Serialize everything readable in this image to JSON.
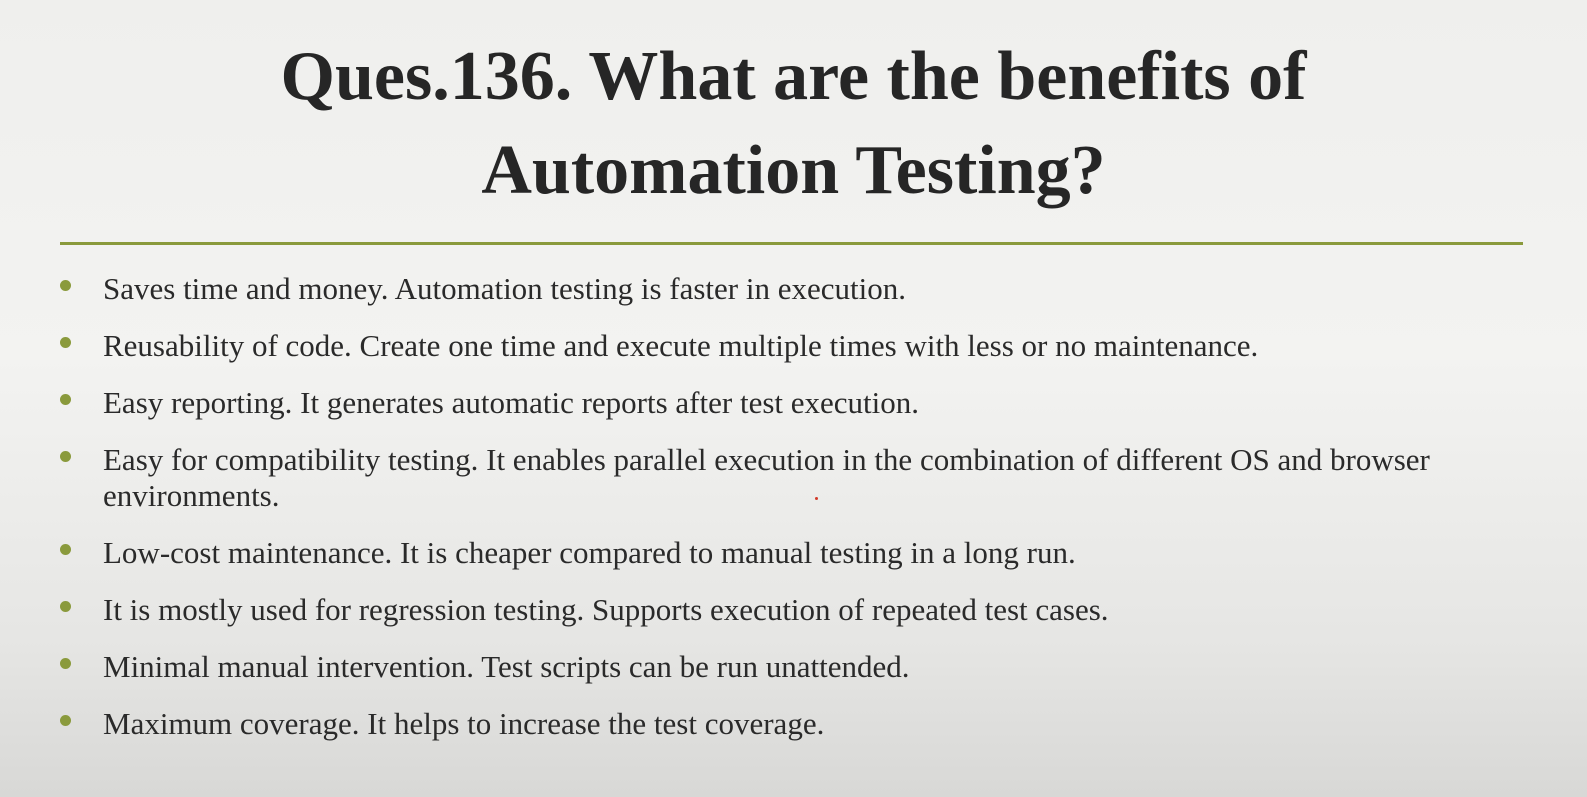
{
  "slide": {
    "title_line1": "Ques.136. What are the benefits of",
    "title_line2": "Automation Testing?",
    "accent_color": "#8a9a3c",
    "bullets": [
      "Saves time and money. Automation testing is faster in execution.",
      "Reusability of code. Create one time and execute multiple times with less or no maintenance.",
      "Easy reporting. It generates automatic reports after test execution.",
      "Easy for compatibility testing. It enables parallel execution in the combination of different OS and browser environments.",
      "Low-cost maintenance. It is cheaper compared to manual testing in a long run.",
      "It is mostly used for regression testing. Supports execution of repeated test cases.",
      "Minimal manual intervention. Test scripts can be run unattended.",
      "Maximum coverage. It helps to increase the test coverage."
    ]
  }
}
